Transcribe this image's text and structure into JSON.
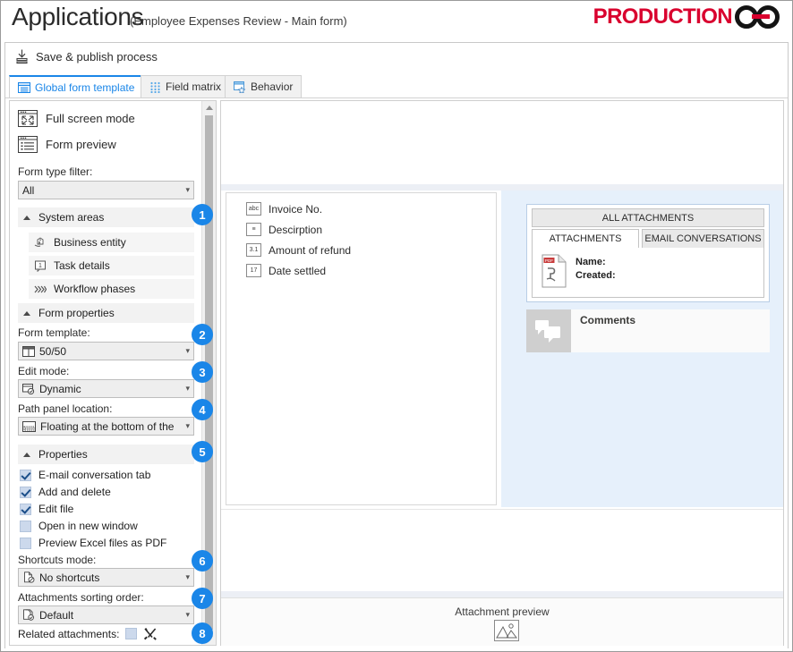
{
  "titlebar": {
    "title": "Applications",
    "subtitle": "(Employee Expenses Review - Main form)",
    "logo_text": "PRODUCTION",
    "logo_mark": "chain-link-icon",
    "logo_color": "#d9002e"
  },
  "command_bar": {
    "save_publish_label": "Save & publish process",
    "save_publish_icon": "save-download-icon"
  },
  "tabs": [
    {
      "label": "Global form template",
      "icon": "form-template-icon",
      "active": true
    },
    {
      "label": "Field matrix",
      "icon": "matrix-icon",
      "active": false
    },
    {
      "label": "Behavior",
      "icon": "behavior-star-icon",
      "active": false
    }
  ],
  "sidebar": {
    "buttons": [
      {
        "label": "Full screen mode",
        "icon": "full-screen-icon"
      },
      {
        "label": "Form preview",
        "icon": "form-preview-icon"
      }
    ],
    "form_type_filter": {
      "label": "Form type filter:",
      "value": "All"
    },
    "system_areas": {
      "label": "System areas",
      "expanded": true,
      "items": [
        {
          "label": "Business entity",
          "icon": "business-entity-icon"
        },
        {
          "label": "Task details",
          "icon": "task-details-icon"
        },
        {
          "label": "Workflow phases",
          "icon": "workflow-phases-icon"
        }
      ]
    },
    "form_properties": {
      "label": "Form properties",
      "expanded": true,
      "fields": [
        {
          "label": "Form template:",
          "value": "50/50",
          "icon": "two-column-layout-icon"
        },
        {
          "label": "Edit mode:",
          "value": "Dynamic",
          "icon": "dynamic-edit-icon"
        },
        {
          "label": "Path panel location:",
          "value": "Floating at the bottom of the",
          "icon": "path-panel-icon"
        }
      ]
    },
    "properties": {
      "label": "Properties",
      "expanded": true,
      "checkboxes": [
        {
          "label": "E-mail conversation tab",
          "checked": true
        },
        {
          "label": "Add and delete",
          "checked": true
        },
        {
          "label": "Edit file",
          "checked": true
        },
        {
          "label": "Open in new window",
          "checked": false
        },
        {
          "label": "Preview Excel files as PDF",
          "checked": false
        }
      ],
      "shortcuts": {
        "label": "Shortcuts mode:",
        "value": "No shortcuts",
        "icon": "no-shortcuts-icon"
      },
      "sorting": {
        "label": "Attachments sorting order:",
        "value": "Default",
        "icon": "sorting-order-icon"
      },
      "related": {
        "label": "Related attachments:",
        "checked": false,
        "tools_icon": "tools-icon"
      }
    },
    "badges": [
      "1",
      "2",
      "3",
      "4",
      "5",
      "6",
      "7",
      "8"
    ],
    "badge_color": "#1a86e8"
  },
  "form_preview": {
    "fields": [
      {
        "label": "Invoice No.",
        "icon": "text-field-icon",
        "glyph": "abc"
      },
      {
        "label": "Descirption",
        "icon": "multiline-text-icon",
        "glyph": "≡"
      },
      {
        "label": "Amount of refund",
        "icon": "decimal-field-icon",
        "glyph": "3.1"
      },
      {
        "label": "Date settled",
        "icon": "date-field-icon",
        "glyph": "17"
      }
    ],
    "attachments": {
      "all_label": "ALL ATTACHMENTS",
      "tabs": [
        {
          "label": "ATTACHMENTS",
          "selected": true
        },
        {
          "label": "EMAIL CONVERSATIONS",
          "selected": false
        }
      ],
      "file_icon": "pdf-file-icon",
      "meta": [
        "Name:",
        "Created:"
      ]
    },
    "comments": {
      "title": "Comments",
      "icon": "comments-bubble-icon"
    },
    "attachment_preview": {
      "label": "Attachment preview",
      "icon": "image-placeholder-icon"
    },
    "panel_bg": "#e6f0fb"
  }
}
